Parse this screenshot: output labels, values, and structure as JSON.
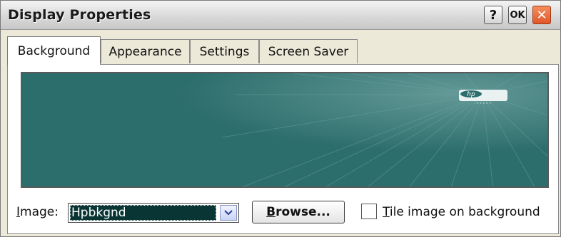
{
  "window": {
    "title": "Display Properties",
    "buttons": {
      "help": "?",
      "ok": "OK",
      "close": "✕"
    }
  },
  "tabs": [
    {
      "label": "Background",
      "active": true
    },
    {
      "label": "Appearance",
      "active": false
    },
    {
      "label": "Settings",
      "active": false
    },
    {
      "label": "Screen Saver",
      "active": false
    }
  ],
  "preview": {
    "logo_text": "hp",
    "logo_sub": "invent"
  },
  "image_field": {
    "label_accel": "I",
    "label_rest": "mage:",
    "value": "Hpbkgnd",
    "dropdown_icon": "chevron-down-icon"
  },
  "browse_button": {
    "accel": "B",
    "rest": "rowse..."
  },
  "tile_option": {
    "accel": "T",
    "rest": "ile image on background",
    "checked": false
  },
  "colors": {
    "preview_bg": "#2c6e6c",
    "selection_bg": "#0a3535",
    "close_button": "#e2562b"
  }
}
